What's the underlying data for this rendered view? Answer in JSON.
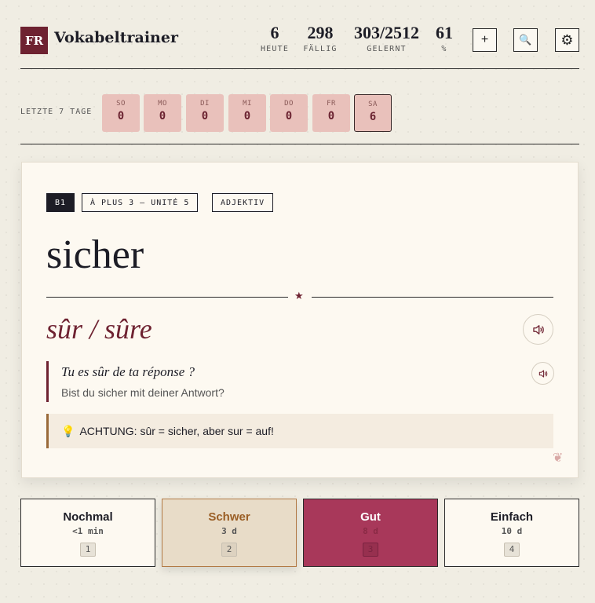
{
  "header": {
    "logo": "FR",
    "title": "Vokabeltrainer",
    "stats": [
      {
        "value": "6",
        "label": "HEUTE"
      },
      {
        "value": "298",
        "label": "FÄLLIG"
      },
      {
        "value": "303/2512",
        "label": "GELERNT"
      },
      {
        "value": "61",
        "label": "%"
      }
    ],
    "add_icon": "+",
    "search_icon": "🔍",
    "settings_icon": "⚙"
  },
  "last_days": {
    "label": "LETZTE 7 TAGE",
    "days": [
      {
        "name": "SO",
        "count": "0"
      },
      {
        "name": "MO",
        "count": "0"
      },
      {
        "name": "DI",
        "count": "0"
      },
      {
        "name": "MI",
        "count": "0"
      },
      {
        "name": "DO",
        "count": "0"
      },
      {
        "name": "FR",
        "count": "0"
      },
      {
        "name": "SA",
        "count": "6"
      }
    ]
  },
  "card": {
    "tags": [
      "B1",
      "À PLUS 3 – UNITÉ 5",
      "ADJEKTIV"
    ],
    "word": "sicher",
    "divider_star": "★",
    "translation": "sûr / sûre",
    "example_fr": "Tu es sûr de ta réponse ?",
    "example_de": "Bist du sicher mit deiner Antwort?",
    "note_icon": "💡",
    "note": "ACHTUNG: sûr = sicher, aber sur = auf!",
    "favorite_icon": "❦"
  },
  "answers": [
    {
      "label": "Nochmal",
      "time": "<1 min",
      "key": "1"
    },
    {
      "label": "Schwer",
      "time": "3 d",
      "key": "2"
    },
    {
      "label": "Gut",
      "time": "8 d",
      "key": "3"
    },
    {
      "label": "Einfach",
      "time": "10 d",
      "key": "4"
    }
  ],
  "colors": {
    "accent": "#6e2231",
    "good": "#a8385a",
    "hard_bg": "#e8dcc8",
    "day_bg": "#e9c1bb",
    "background": "#f0ede3"
  }
}
